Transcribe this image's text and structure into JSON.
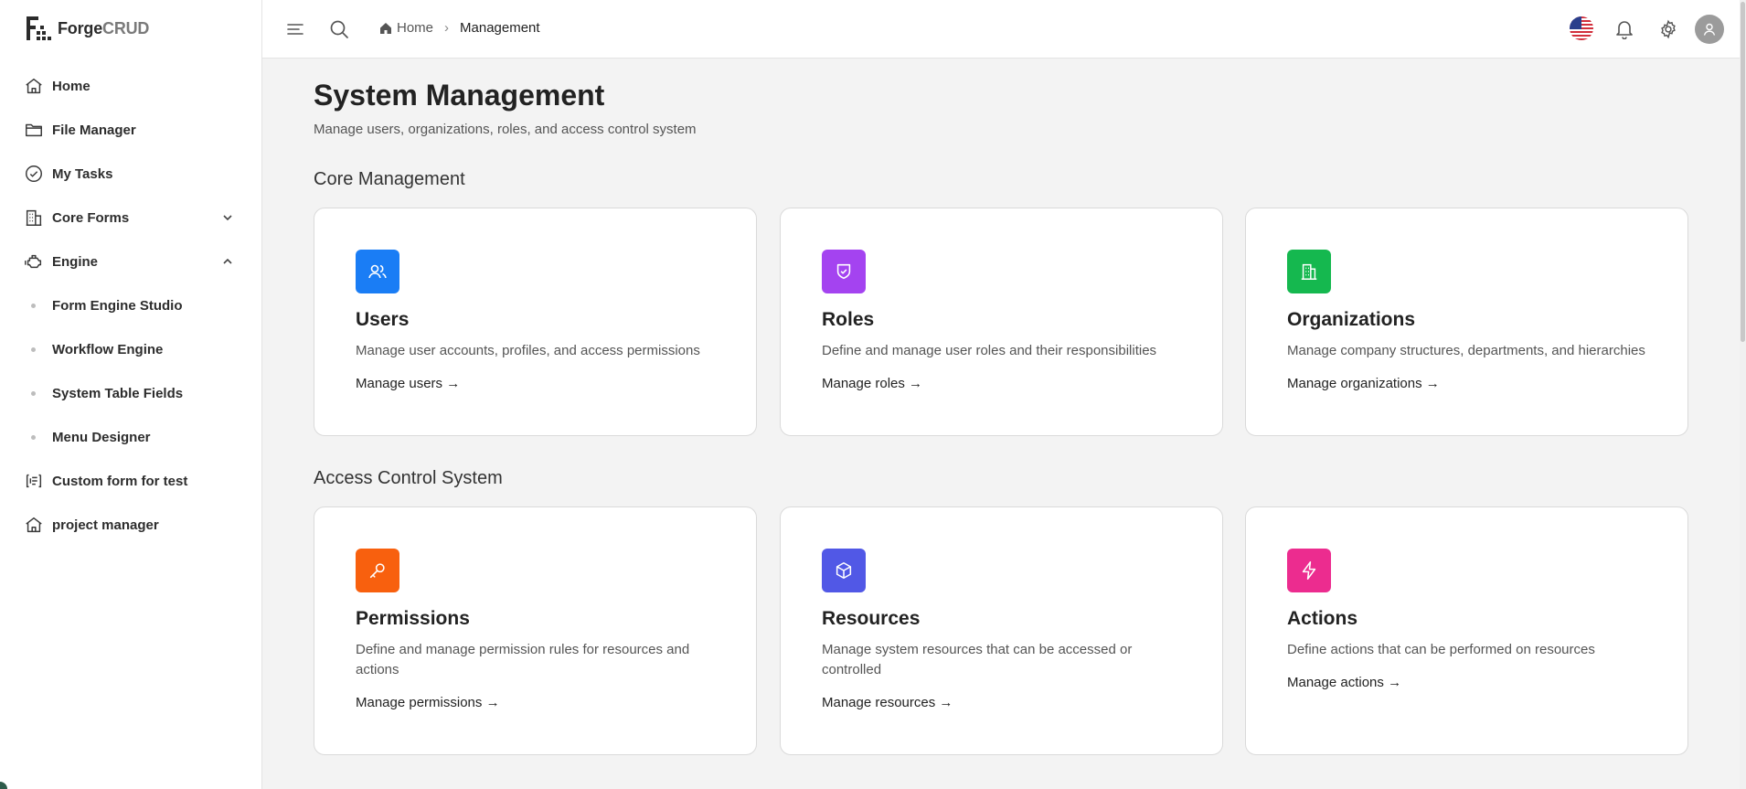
{
  "brand": {
    "name_a": "Forge",
    "name_b": "CRUD"
  },
  "sidebar": {
    "items": [
      {
        "label": "Home"
      },
      {
        "label": "File Manager"
      },
      {
        "label": "My Tasks"
      },
      {
        "label": "Core Forms"
      },
      {
        "label": "Engine"
      },
      {
        "label": "Form Engine Studio"
      },
      {
        "label": "Workflow Engine"
      },
      {
        "label": "System Table Fields"
      },
      {
        "label": "Menu Designer"
      },
      {
        "label": "Custom form for test"
      },
      {
        "label": "project manager"
      }
    ]
  },
  "breadcrumb": {
    "home": "Home",
    "separator": "›",
    "current": "Management"
  },
  "page": {
    "title": "System Management",
    "subtitle": "Manage users, organizations, roles, and access control system"
  },
  "sections": {
    "core": {
      "title": "Core Management",
      "cards": [
        {
          "title": "Users",
          "description": "Manage user accounts, profiles, and access permissions",
          "link": "Manage users →",
          "color": "#1a7df5",
          "icon": "users-icon"
        },
        {
          "title": "Roles",
          "description": "Define and manage user roles and their responsibilities",
          "link": "Manage roles →",
          "color": "#a443f0",
          "icon": "shield-check-icon"
        },
        {
          "title": "Organizations",
          "description": "Manage company structures, departments, and hierarchies",
          "link": "Manage organizations →",
          "color": "#15b84f",
          "icon": "building-icon"
        }
      ]
    },
    "access": {
      "title": "Access Control System",
      "cards": [
        {
          "title": "Permissions",
          "description": "Define and manage permission rules for resources and actions",
          "link": "Manage permissions →",
          "color": "#f8600e",
          "icon": "key-icon"
        },
        {
          "title": "Resources",
          "description": "Manage system resources that can be accessed or controlled",
          "link": "Manage resources →",
          "color": "#5158e6",
          "icon": "cube-icon"
        },
        {
          "title": "Actions",
          "description": "Define actions that can be performed on resources",
          "link": "Manage actions →",
          "color": "#ec2c8f",
          "icon": "lightning-icon"
        }
      ]
    }
  }
}
